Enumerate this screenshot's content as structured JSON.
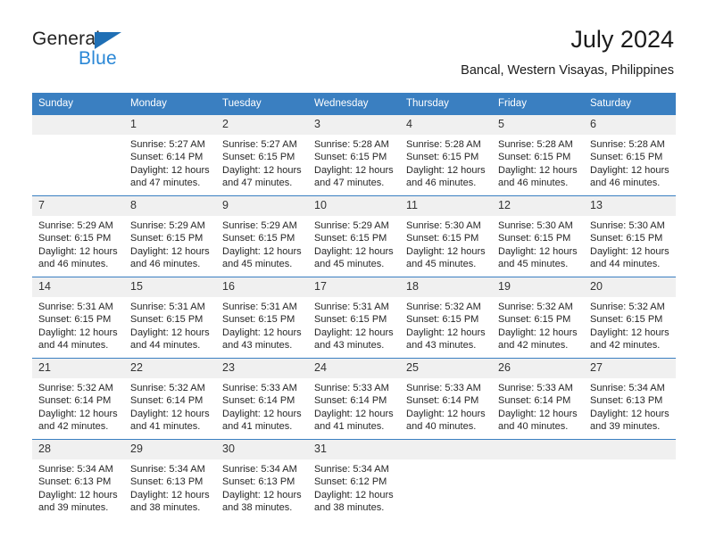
{
  "brand": {
    "word_one": "General",
    "word_two": "Blue",
    "triangle_color": "#1f6fb5",
    "blue_text_color": "#2a87d6"
  },
  "header": {
    "title": "July 2024",
    "subtitle": "Bancal, Western Visayas, Philippines"
  },
  "calendar": {
    "header_bg": "#3a7fc1",
    "daynum_bg": "#f0f0f0",
    "weekday_headers": [
      "Sunday",
      "Monday",
      "Tuesday",
      "Wednesday",
      "Thursday",
      "Friday",
      "Saturday"
    ],
    "weeks": [
      [
        {
          "day": "",
          "sunrise": "",
          "sunset": "",
          "daylight": "",
          "empty": true
        },
        {
          "day": "1",
          "sunrise": "Sunrise: 5:27 AM",
          "sunset": "Sunset: 6:14 PM",
          "daylight": "Daylight: 12 hours and 47 minutes."
        },
        {
          "day": "2",
          "sunrise": "Sunrise: 5:27 AM",
          "sunset": "Sunset: 6:15 PM",
          "daylight": "Daylight: 12 hours and 47 minutes."
        },
        {
          "day": "3",
          "sunrise": "Sunrise: 5:28 AM",
          "sunset": "Sunset: 6:15 PM",
          "daylight": "Daylight: 12 hours and 47 minutes."
        },
        {
          "day": "4",
          "sunrise": "Sunrise: 5:28 AM",
          "sunset": "Sunset: 6:15 PM",
          "daylight": "Daylight: 12 hours and 46 minutes."
        },
        {
          "day": "5",
          "sunrise": "Sunrise: 5:28 AM",
          "sunset": "Sunset: 6:15 PM",
          "daylight": "Daylight: 12 hours and 46 minutes."
        },
        {
          "day": "6",
          "sunrise": "Sunrise: 5:28 AM",
          "sunset": "Sunset: 6:15 PM",
          "daylight": "Daylight: 12 hours and 46 minutes."
        }
      ],
      [
        {
          "day": "7",
          "sunrise": "Sunrise: 5:29 AM",
          "sunset": "Sunset: 6:15 PM",
          "daylight": "Daylight: 12 hours and 46 minutes."
        },
        {
          "day": "8",
          "sunrise": "Sunrise: 5:29 AM",
          "sunset": "Sunset: 6:15 PM",
          "daylight": "Daylight: 12 hours and 46 minutes."
        },
        {
          "day": "9",
          "sunrise": "Sunrise: 5:29 AM",
          "sunset": "Sunset: 6:15 PM",
          "daylight": "Daylight: 12 hours and 45 minutes."
        },
        {
          "day": "10",
          "sunrise": "Sunrise: 5:29 AM",
          "sunset": "Sunset: 6:15 PM",
          "daylight": "Daylight: 12 hours and 45 minutes."
        },
        {
          "day": "11",
          "sunrise": "Sunrise: 5:30 AM",
          "sunset": "Sunset: 6:15 PM",
          "daylight": "Daylight: 12 hours and 45 minutes."
        },
        {
          "day": "12",
          "sunrise": "Sunrise: 5:30 AM",
          "sunset": "Sunset: 6:15 PM",
          "daylight": "Daylight: 12 hours and 45 minutes."
        },
        {
          "day": "13",
          "sunrise": "Sunrise: 5:30 AM",
          "sunset": "Sunset: 6:15 PM",
          "daylight": "Daylight: 12 hours and 44 minutes."
        }
      ],
      [
        {
          "day": "14",
          "sunrise": "Sunrise: 5:31 AM",
          "sunset": "Sunset: 6:15 PM",
          "daylight": "Daylight: 12 hours and 44 minutes."
        },
        {
          "day": "15",
          "sunrise": "Sunrise: 5:31 AM",
          "sunset": "Sunset: 6:15 PM",
          "daylight": "Daylight: 12 hours and 44 minutes."
        },
        {
          "day": "16",
          "sunrise": "Sunrise: 5:31 AM",
          "sunset": "Sunset: 6:15 PM",
          "daylight": "Daylight: 12 hours and 43 minutes."
        },
        {
          "day": "17",
          "sunrise": "Sunrise: 5:31 AM",
          "sunset": "Sunset: 6:15 PM",
          "daylight": "Daylight: 12 hours and 43 minutes."
        },
        {
          "day": "18",
          "sunrise": "Sunrise: 5:32 AM",
          "sunset": "Sunset: 6:15 PM",
          "daylight": "Daylight: 12 hours and 43 minutes."
        },
        {
          "day": "19",
          "sunrise": "Sunrise: 5:32 AM",
          "sunset": "Sunset: 6:15 PM",
          "daylight": "Daylight: 12 hours and 42 minutes."
        },
        {
          "day": "20",
          "sunrise": "Sunrise: 5:32 AM",
          "sunset": "Sunset: 6:15 PM",
          "daylight": "Daylight: 12 hours and 42 minutes."
        }
      ],
      [
        {
          "day": "21",
          "sunrise": "Sunrise: 5:32 AM",
          "sunset": "Sunset: 6:14 PM",
          "daylight": "Daylight: 12 hours and 42 minutes."
        },
        {
          "day": "22",
          "sunrise": "Sunrise: 5:32 AM",
          "sunset": "Sunset: 6:14 PM",
          "daylight": "Daylight: 12 hours and 41 minutes."
        },
        {
          "day": "23",
          "sunrise": "Sunrise: 5:33 AM",
          "sunset": "Sunset: 6:14 PM",
          "daylight": "Daylight: 12 hours and 41 minutes."
        },
        {
          "day": "24",
          "sunrise": "Sunrise: 5:33 AM",
          "sunset": "Sunset: 6:14 PM",
          "daylight": "Daylight: 12 hours and 41 minutes."
        },
        {
          "day": "25",
          "sunrise": "Sunrise: 5:33 AM",
          "sunset": "Sunset: 6:14 PM",
          "daylight": "Daylight: 12 hours and 40 minutes."
        },
        {
          "day": "26",
          "sunrise": "Sunrise: 5:33 AM",
          "sunset": "Sunset: 6:14 PM",
          "daylight": "Daylight: 12 hours and 40 minutes."
        },
        {
          "day": "27",
          "sunrise": "Sunrise: 5:34 AM",
          "sunset": "Sunset: 6:13 PM",
          "daylight": "Daylight: 12 hours and 39 minutes."
        }
      ],
      [
        {
          "day": "28",
          "sunrise": "Sunrise: 5:34 AM",
          "sunset": "Sunset: 6:13 PM",
          "daylight": "Daylight: 12 hours and 39 minutes."
        },
        {
          "day": "29",
          "sunrise": "Sunrise: 5:34 AM",
          "sunset": "Sunset: 6:13 PM",
          "daylight": "Daylight: 12 hours and 38 minutes."
        },
        {
          "day": "30",
          "sunrise": "Sunrise: 5:34 AM",
          "sunset": "Sunset: 6:13 PM",
          "daylight": "Daylight: 12 hours and 38 minutes."
        },
        {
          "day": "31",
          "sunrise": "Sunrise: 5:34 AM",
          "sunset": "Sunset: 6:12 PM",
          "daylight": "Daylight: 12 hours and 38 minutes."
        },
        {
          "day": "",
          "sunrise": "",
          "sunset": "",
          "daylight": "",
          "empty": true
        },
        {
          "day": "",
          "sunrise": "",
          "sunset": "",
          "daylight": "",
          "empty": true
        },
        {
          "day": "",
          "sunrise": "",
          "sunset": "",
          "daylight": "",
          "empty": true
        }
      ]
    ]
  }
}
